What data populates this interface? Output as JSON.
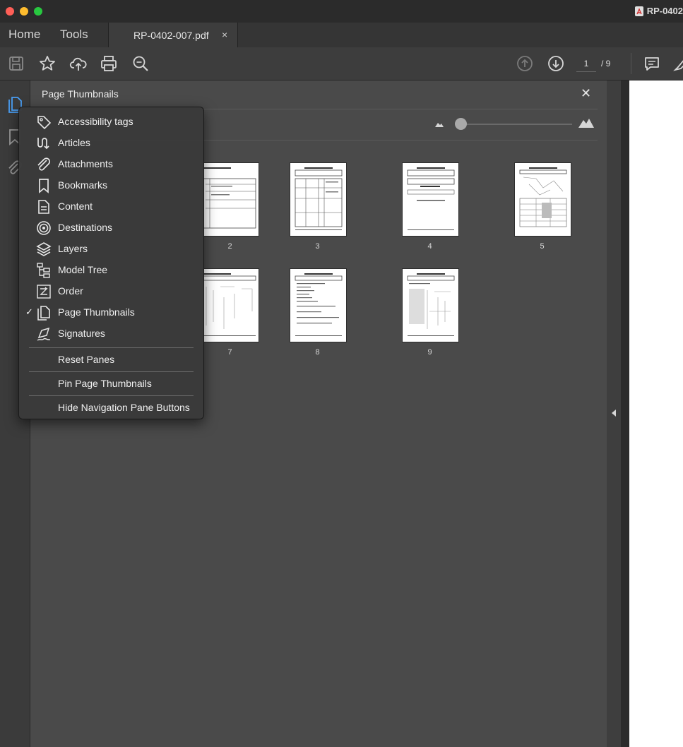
{
  "window": {
    "title": "RP-0402",
    "traffic_lights": [
      "#ff5f57",
      "#febc2e",
      "#28c840"
    ]
  },
  "tabs": {
    "home": "Home",
    "tools": "Tools",
    "document": "RP-0402-007.pdf",
    "close_symbol": "×"
  },
  "toolbar": {
    "icons": [
      "save-icon",
      "star-icon",
      "upload-cloud-icon",
      "print-icon",
      "zoom-search-icon",
      "page-up-icon",
      "page-down-icon",
      "comment-icon",
      "highlight-pen-icon"
    ],
    "current_page": "1",
    "total_pages": "/ 9"
  },
  "left_rail": {
    "icons": [
      "page-thumbnails-icon",
      "bookmark-icon",
      "attachment-icon"
    ],
    "accent": "#4a9ff5"
  },
  "thumbnails_panel": {
    "title": "Page Thumbnails",
    "close_symbol": "✕",
    "thumbnail_size_level": 0.0,
    "pages": [
      {
        "label": "2"
      },
      {
        "label": "3"
      },
      {
        "label": "4"
      },
      {
        "label": "5"
      },
      {
        "label": "7"
      },
      {
        "label": "8"
      },
      {
        "label": "9"
      }
    ]
  },
  "context_menu": {
    "items": [
      {
        "label": "Accessibility tags",
        "icon": "tag-icon",
        "checked": false
      },
      {
        "label": "Articles",
        "icon": "articles-icon",
        "checked": false
      },
      {
        "label": "Attachments",
        "icon": "paperclip-icon",
        "checked": false
      },
      {
        "label": "Bookmarks",
        "icon": "bookmark-icon",
        "checked": false
      },
      {
        "label": "Content",
        "icon": "content-icon",
        "checked": false
      },
      {
        "label": "Destinations",
        "icon": "target-icon",
        "checked": false
      },
      {
        "label": "Layers",
        "icon": "layers-icon",
        "checked": false
      },
      {
        "label": "Model Tree",
        "icon": "model-tree-icon",
        "checked": false
      },
      {
        "label": "Order",
        "icon": "order-icon",
        "checked": false
      },
      {
        "label": "Page Thumbnails",
        "icon": "page-thumbnails-icon",
        "checked": true
      },
      {
        "label": "Signatures",
        "icon": "signature-pen-icon",
        "checked": false
      }
    ],
    "check_symbol": "✓",
    "reset_panes": "Reset Panes",
    "pin_page_thumbnails": "Pin Page Thumbnails",
    "hide_nav_buttons": "Hide Navigation Pane Buttons"
  }
}
